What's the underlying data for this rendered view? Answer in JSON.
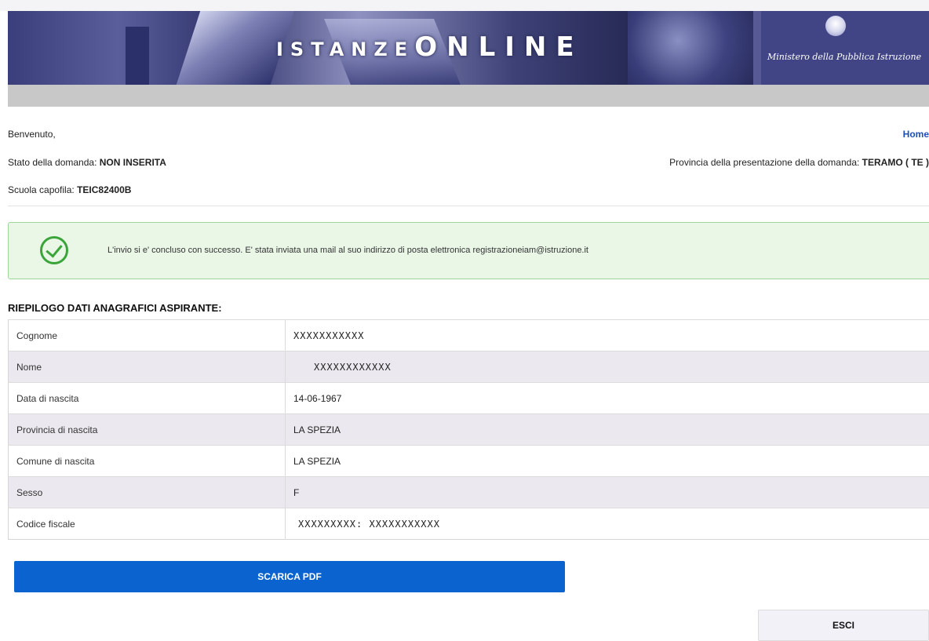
{
  "banner": {
    "logo_text_1": "ISTANZ",
    "logo_text_2": "E",
    "logo_text_3": "ON",
    "logo_text_4": "LINE",
    "ministry": "Ministero della Pubblica Istruzione",
    "emblem_icon": "italian-republic-emblem"
  },
  "header": {
    "welcome": "Benvenuto,",
    "home_link": "Home",
    "status_label": "Stato della domanda:",
    "status_value": "NON INSERITA",
    "province_label": "Provincia della presentazione della domanda:",
    "province_value": "TERAMO ( TE )",
    "school_label": "Scuola capofila:",
    "school_value": "TEIC82400B"
  },
  "alert": {
    "icon": "check-circle-icon",
    "message": "L'invio si e' concluso con successo. E' stata inviata una mail al suo indirizzo di posta elettronica registrazioneiam@istruzione.it",
    "color": "#3ba53b"
  },
  "summary": {
    "title": "RIEPILOGO DATI ANAGRAFICI ASPIRANTE:",
    "rows": [
      {
        "label": "Cognome",
        "value": "XXXXXXXXXXX"
      },
      {
        "label": "Nome",
        "value": "XXXXXXXXXXXX"
      },
      {
        "label": "Data di nascita",
        "value": "14-06-1967"
      },
      {
        "label": "Provincia di nascita",
        "value": "LA SPEZIA"
      },
      {
        "label": "Comune di nascita",
        "value": "LA SPEZIA"
      },
      {
        "label": "Sesso",
        "value": "F"
      },
      {
        "label": "Codice fiscale",
        "value": "XXXXXXXXX: XXXXXXXXXXX"
      }
    ]
  },
  "actions": {
    "download_pdf": "SCARICA PDF",
    "exit": "ESCI",
    "primary_color": "#0b63d0"
  }
}
